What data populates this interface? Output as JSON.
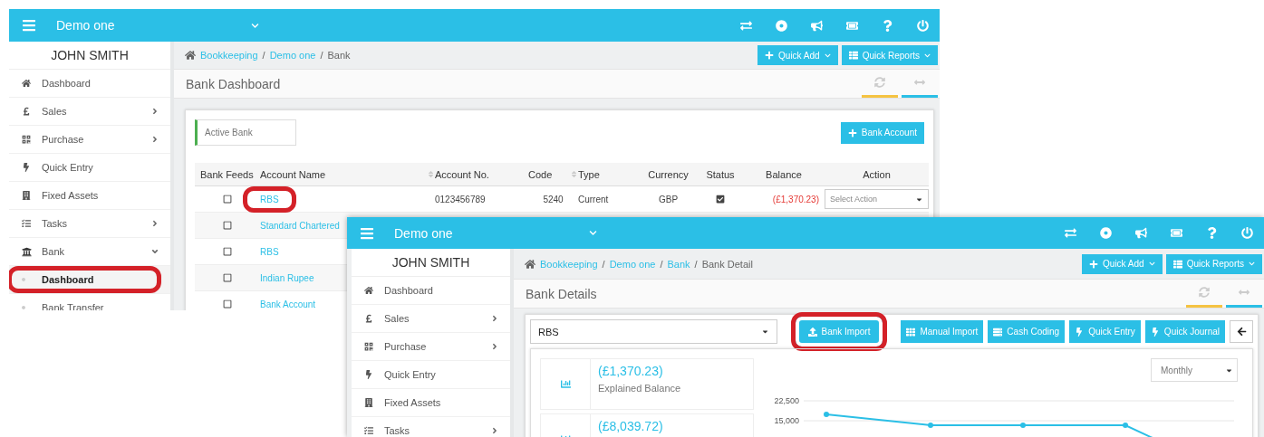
{
  "window_back": {
    "topbar": {
      "company": "Demo one"
    },
    "sidebar": {
      "user": "JOHN SMITH",
      "items": [
        {
          "label": "Dashboard",
          "kind": "home",
          "selected": false,
          "highlighted": false
        },
        {
          "label": "Sales",
          "kind": "pound",
          "expanded": false,
          "selected": false,
          "highlighted": false
        },
        {
          "label": "Purchase",
          "kind": "grid",
          "expanded": false,
          "selected": false,
          "highlighted": false
        },
        {
          "label": "Quick Entry",
          "kind": "bolt",
          "selected": false,
          "highlighted": false
        },
        {
          "label": "Fixed Assets",
          "kind": "building",
          "selected": false,
          "highlighted": false
        },
        {
          "label": "Tasks",
          "kind": "tasks",
          "expanded": false,
          "selected": false,
          "highlighted": false
        },
        {
          "label": "Bank",
          "kind": "bank",
          "expanded": true,
          "selected": false,
          "highlighted": false
        },
        {
          "label": "Dashboard",
          "kind": "sub",
          "selected": true,
          "highlighted": true
        },
        {
          "label": "Bank Transfer",
          "kind": "sub",
          "selected": false,
          "highlighted": false
        }
      ]
    },
    "breadcrumb": [
      {
        "label": "Bookkeeping",
        "link": true,
        "separator": "/"
      },
      {
        "label": "Demo one",
        "link": true,
        "separator": "/"
      },
      {
        "label": "Bank",
        "link": false
      }
    ],
    "header_buttons": [
      {
        "label": "Quick Add",
        "kind": "add"
      },
      {
        "label": "Quick Reports",
        "kind": "reports"
      }
    ],
    "page_title": "Bank Dashboard",
    "filter": {
      "value": "Active Bank"
    },
    "add_button": "Bank Account",
    "table": {
      "columns": [
        {
          "label": "Bank Feeds",
          "sortable": false
        },
        {
          "label": "Account Name",
          "sortable": true
        },
        {
          "label": "Account No.",
          "sortable": false
        },
        {
          "label": "Code",
          "sortable": true
        },
        {
          "label": "Type",
          "sortable": false
        },
        {
          "label": "Currency",
          "sortable": false
        },
        {
          "label": "Status",
          "sortable": false
        },
        {
          "label": "Balance",
          "sortable": false
        },
        {
          "label": "Action",
          "sortable": false
        }
      ],
      "rows": [
        {
          "checked": false,
          "account_name": "RBS",
          "highlighted": true,
          "account_no": "0123456789",
          "code": "5240",
          "type": "Current",
          "currency": "GBP",
          "status_checked": true,
          "balance": "(£1,370.23)",
          "negative": true,
          "action": "Select Action"
        },
        {
          "checked": false,
          "account_name": "Standard Chartered",
          "highlighted": false
        },
        {
          "checked": false,
          "account_name": "RBS",
          "highlighted": false
        },
        {
          "checked": false,
          "account_name": "Indian Rupee",
          "highlighted": false
        },
        {
          "checked": false,
          "account_name": "Bank Account",
          "highlighted": false
        }
      ]
    }
  },
  "window_front": {
    "topbar": {
      "company": "Demo one"
    },
    "sidebar": {
      "user": "JOHN SMITH",
      "items": [
        {
          "label": "Dashboard",
          "kind": "home",
          "selected": false,
          "highlighted": false
        },
        {
          "label": "Sales",
          "kind": "pound",
          "expanded": false,
          "selected": false,
          "highlighted": false
        },
        {
          "label": "Purchase",
          "kind": "grid",
          "expanded": false,
          "selected": false,
          "highlighted": false
        },
        {
          "label": "Quick Entry",
          "kind": "bolt",
          "selected": false,
          "highlighted": false
        },
        {
          "label": "Fixed Assets",
          "kind": "building",
          "selected": false,
          "highlighted": false
        },
        {
          "label": "Tasks",
          "kind": "tasks",
          "expanded": false,
          "selected": false,
          "highlighted": false
        }
      ]
    },
    "breadcrumb": [
      {
        "label": "Bookkeeping",
        "link": true,
        "separator": "/"
      },
      {
        "label": "Demo one",
        "link": true,
        "separator": "/"
      },
      {
        "label": "Bank",
        "link": true,
        "separator": "/"
      },
      {
        "label": "Bank Detail",
        "link": false
      }
    ],
    "header_buttons": [
      {
        "label": "Quick Add",
        "kind": "add"
      },
      {
        "label": "Quick Reports",
        "kind": "reports"
      }
    ],
    "page_title": "Bank Details",
    "bank_select": "RBS",
    "actions": [
      {
        "label": "Bank Import",
        "kind": "upload",
        "highlighted": true
      },
      {
        "label": "Manual Import",
        "kind": "grid",
        "highlighted": false
      },
      {
        "label": "Cash Coding",
        "kind": "coding",
        "highlighted": false
      },
      {
        "label": "Quick Entry",
        "kind": "bolt",
        "highlighted": false
      },
      {
        "label": "Quick Journal",
        "kind": "bolt",
        "highlighted": false
      }
    ],
    "summaries": [
      {
        "amount": "(£1,370.23)",
        "label": "Explained Balance"
      },
      {
        "amount": "(£8,039.72)"
      }
    ],
    "period_select": "Monthly",
    "chart": {
      "y_labels": [
        "22,500",
        "15,000"
      ]
    }
  }
}
